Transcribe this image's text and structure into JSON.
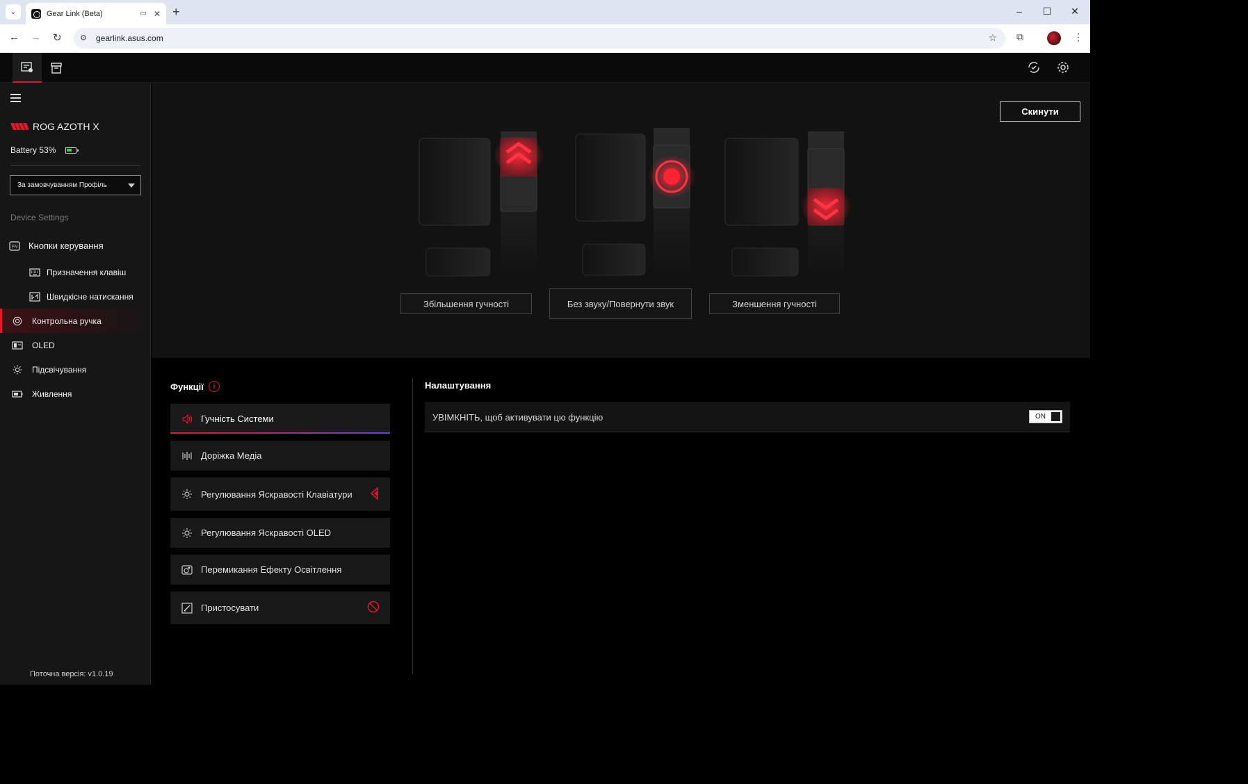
{
  "browser": {
    "tab_title": "Gear Link (Beta)",
    "url": "gearlink.asus.com",
    "tab_menu_icon": "chevron-down-icon",
    "new_tab_icon": "plus-icon"
  },
  "sidebar": {
    "device_name": "ROG AZOTH X",
    "battery_label": "Battery 53%",
    "battery_level_percent": 53,
    "profile_selected": "За замовчуванням Профіль",
    "section_label": "Device Settings",
    "items": [
      {
        "label": "Кнопки керування",
        "icon": "fn-key-icon"
      },
      {
        "label": "Призначення клавіш",
        "icon": "keyboard-icon"
      },
      {
        "label": "Швидкісне натискання",
        "icon": "rapid-trigger-icon"
      },
      {
        "label": "Контрольна ручка",
        "icon": "knob-icon",
        "active": true
      },
      {
        "label": "OLED",
        "icon": "oled-icon"
      },
      {
        "label": "Підсвічування",
        "icon": "lighting-icon"
      },
      {
        "label": "Живлення",
        "icon": "power-icon"
      }
    ],
    "version": "Поточна версія: v1.0.19"
  },
  "main": {
    "reset_label": "Скинути",
    "actions": [
      {
        "label": "Збільшення гучності"
      },
      {
        "label": "Без звуку/Повернути звук"
      },
      {
        "label": "Зменшення гучності"
      }
    ]
  },
  "functions": {
    "title": "Функції",
    "items": [
      {
        "label": "Гучність Системи",
        "icon": "speaker-icon",
        "active": true
      },
      {
        "label": "Доріжка Медіа",
        "icon": "media-bars-icon"
      },
      {
        "label": "Регулювання Яскравості Клавіатури",
        "icon": "brightness-icon",
        "indicator": "red-arrow-icon"
      },
      {
        "label": "Регулювання Яскравості OLED",
        "icon": "brightness-icon"
      },
      {
        "label": "Перемикання Ефекту Освітлення",
        "icon": "lighting-effect-icon"
      },
      {
        "label": "Пристосувати",
        "icon": "edit-icon",
        "indicator": "prohibited-icon"
      }
    ]
  },
  "settings": {
    "title": "Налаштування",
    "row_text": "УВІМКНІТЬ, щоб активувати цю функцію",
    "toggle_label": "ON",
    "toggle_on": true
  },
  "colors": {
    "accent": "#e3162b",
    "background": "#000000",
    "sidebar": "#161616",
    "panel": "#121212"
  }
}
